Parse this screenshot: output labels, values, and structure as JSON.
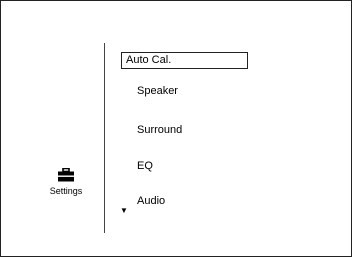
{
  "sidebar": {
    "settings_label": "Settings",
    "settings_icon": "toolbox-icon"
  },
  "menu": {
    "items": [
      {
        "label": "Auto Cal.",
        "selected": true
      },
      {
        "label": "Speaker",
        "selected": false
      },
      {
        "label": "Surround",
        "selected": false
      },
      {
        "label": "EQ",
        "selected": false
      },
      {
        "label": "Audio",
        "selected": false
      }
    ],
    "more_indicator": "▼"
  },
  "colors": {
    "background": "#ffffff",
    "foreground": "#000000",
    "border": "#222222"
  }
}
